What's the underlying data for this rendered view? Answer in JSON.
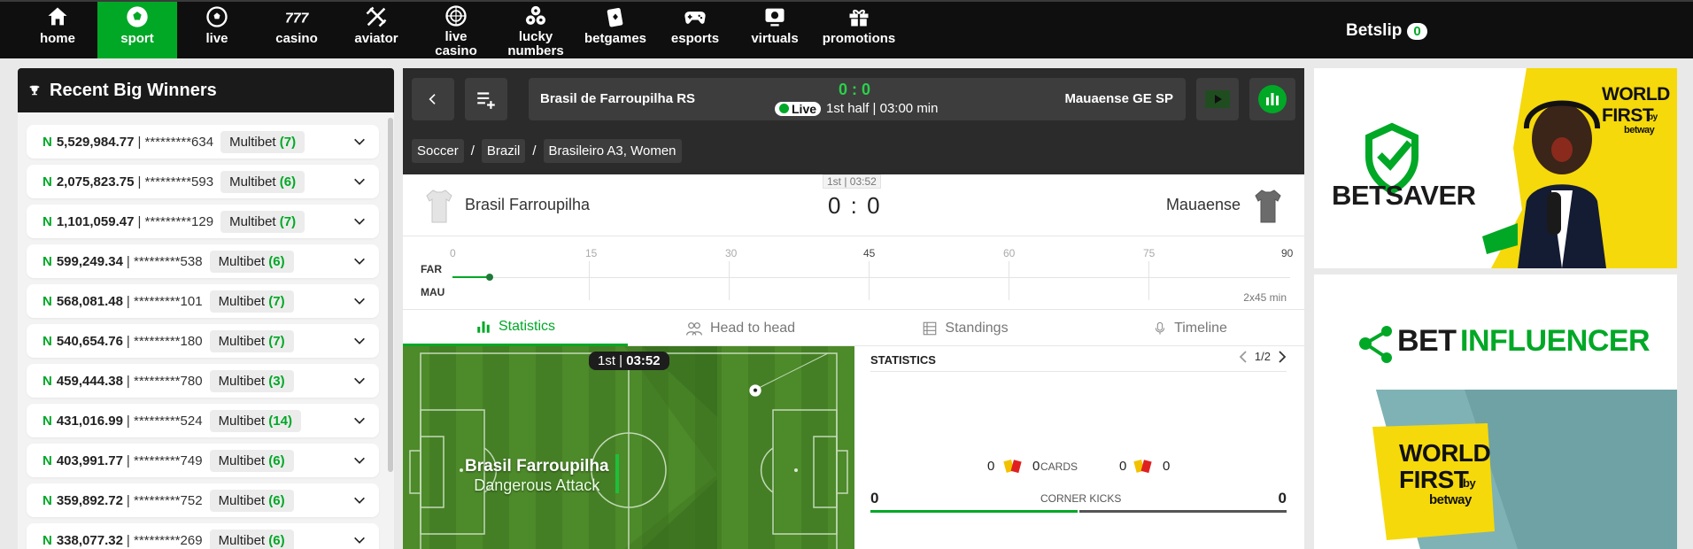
{
  "nav": {
    "items": [
      {
        "label": "home",
        "icon": "home-icon"
      },
      {
        "label": "sport",
        "icon": "soccer-ball-icon",
        "active": true
      },
      {
        "label": "live",
        "icon": "live-ball-icon"
      },
      {
        "label": "casino",
        "icon": "slots-777-icon"
      },
      {
        "label": "aviator",
        "icon": "aviator-plane-icon"
      },
      {
        "label": "live\ncasino",
        "icon": "roulette-icon"
      },
      {
        "label": "lucky\nnumbers",
        "icon": "lottery-balls-icon"
      },
      {
        "label": "betgames",
        "icon": "cards-icon"
      },
      {
        "label": "esports",
        "icon": "gamepad-icon"
      },
      {
        "label": "virtuals",
        "icon": "virtual-screen-icon"
      },
      {
        "label": "promotions",
        "icon": "gift-icon"
      }
    ],
    "betslip_label": "Betslip",
    "betslip_count": "0"
  },
  "winners": {
    "title": "Recent Big Winners",
    "currency": "N",
    "rows": [
      {
        "amount": "5,529,984.77",
        "account": "| *********634",
        "bet_type": "Multibet",
        "count": "(7)"
      },
      {
        "amount": "2,075,823.75",
        "account": "| *********593",
        "bet_type": "Multibet",
        "count": "(6)"
      },
      {
        "amount": "1,101,059.47",
        "account": "| *********129",
        "bet_type": "Multibet",
        "count": "(7)"
      },
      {
        "amount": "599,249.34",
        "account": "| *********538",
        "bet_type": "Multibet",
        "count": "(6)"
      },
      {
        "amount": "568,081.48",
        "account": "| *********101",
        "bet_type": "Multibet",
        "count": "(7)"
      },
      {
        "amount": "540,654.76",
        "account": "| *********180",
        "bet_type": "Multibet",
        "count": "(7)"
      },
      {
        "amount": "459,444.38",
        "account": "| *********780",
        "bet_type": "Multibet",
        "count": "(3)"
      },
      {
        "amount": "431,016.99",
        "account": "| *********524",
        "bet_type": "Multibet",
        "count": "(14)"
      },
      {
        "amount": "403,991.77",
        "account": "| *********749",
        "bet_type": "Multibet",
        "count": "(6)"
      },
      {
        "amount": "359,892.72",
        "account": "| *********752",
        "bet_type": "Multibet",
        "count": "(6)"
      },
      {
        "amount": "338,077.32",
        "account": "| *********269",
        "bet_type": "Multibet",
        "count": "(6)"
      }
    ]
  },
  "match": {
    "home_full": "Brasil de Farroupilha RS",
    "away_full": "Mauaense GE SP",
    "live_score": "0 : 0",
    "live_label": "Live",
    "status": "1st half | 03:00 min",
    "breadcrumbs": [
      "Soccer",
      "Brazil",
      "Brasileiro A3, Women"
    ],
    "crumb_sep": "/",
    "clock_small": "1st | 03:52",
    "home_short": "Brasil Farroupilha",
    "away_short": "Mauaense",
    "score": "0 : 0",
    "timeline": {
      "home_code": "FAR",
      "away_code": "MAU",
      "ticks": [
        "0",
        "15",
        "30",
        "45",
        "60",
        "75",
        "90"
      ],
      "duration": "2x45 min",
      "elapsed_minutes": 3
    },
    "tabs": [
      {
        "label": "Statistics",
        "icon": "bar-chart-icon",
        "active": true
      },
      {
        "label": "Head to head",
        "icon": "people-icon"
      },
      {
        "label": "Standings",
        "icon": "standings-icon"
      },
      {
        "label": "Timeline",
        "icon": "microphone-icon"
      }
    ],
    "pitch": {
      "clock_period": "1st",
      "clock_time": "03:52",
      "team": "Brasil Farroupilha",
      "event": "Dangerous Attack"
    },
    "stats": {
      "title": "STATISTICS",
      "page": "1/2",
      "cards_label": "CARDS",
      "home_yellow": "0",
      "home_red": "0",
      "away_yellow": "0",
      "away_red": "0",
      "corners_label": "CORNER KICKS",
      "home_corners": "0",
      "away_corners": "0"
    }
  },
  "ads": {
    "ad1_brand": "BETSAVER",
    "ad1_tag1": "WORLD",
    "ad1_tag2": "FIRST",
    "ad1_by": "by",
    "ad1_sub": "betway",
    "ad2_brand_a": "BET",
    "ad2_brand_b": "INFLUENCER",
    "ad2_tag1": "WORLD",
    "ad2_tag2": "FIRST",
    "ad2_by": "by",
    "ad2_sub": "betway"
  },
  "colors": {
    "accent": "#00a826",
    "nav_bg": "#0f0f0f",
    "panel_dark": "#2b2b2b",
    "ad_yellow": "#f5d90a"
  }
}
